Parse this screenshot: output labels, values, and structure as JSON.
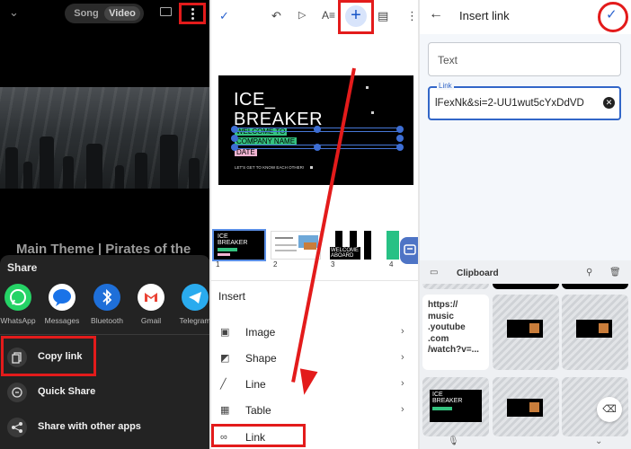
{
  "panel1": {
    "toggle": {
      "song": "Song",
      "video": "Video"
    },
    "video_title": "Main Theme | Pirates of the",
    "share": {
      "title": "Share",
      "apps": [
        {
          "label": "WhatsApp",
          "color": "#25D366"
        },
        {
          "label": "Messages",
          "color": "#1A73E8"
        },
        {
          "label": "Bluetooth",
          "color": "#1E6FD9"
        },
        {
          "label": "Gmail",
          "color": "#FFFFFF"
        },
        {
          "label": "Telegram",
          "color": "#2AABEE"
        }
      ],
      "actions": [
        "Copy link",
        "Quick Share",
        "Share with other apps"
      ]
    }
  },
  "panel2": {
    "slide": {
      "line1": "ICE_",
      "line2": "BREAKER",
      "line3": "WELCOME TO",
      "line4": "COMPANY NAME",
      "line5": "DATE",
      "small": "LET'S GET TO KNOW EACH OTHER!"
    },
    "thumbnails": [
      "1",
      "2",
      "3",
      "4"
    ],
    "thumb1_lines": [
      "ICE",
      "BREAKER"
    ],
    "thumb3_lines": [
      "WELCOME",
      "ABOARD"
    ],
    "insert": {
      "title": "Insert",
      "items": [
        "Image",
        "Shape",
        "Line",
        "Table",
        "Link"
      ]
    }
  },
  "panel3": {
    "title": "Insert link",
    "text_placeholder": "Text",
    "link_label": "Link",
    "link_value": "lFexNk&si=2-UU1wut5cYxDdVD",
    "clipboard": {
      "title": "Clipboard",
      "url_clip": "https://\nmusic\n.youtube\n.com\n/watch?v=...",
      "tile_text": [
        "ICE",
        "BREAKER"
      ]
    }
  },
  "colors": {
    "highlight": "#E31B1B",
    "accent": "#2B63CF"
  }
}
